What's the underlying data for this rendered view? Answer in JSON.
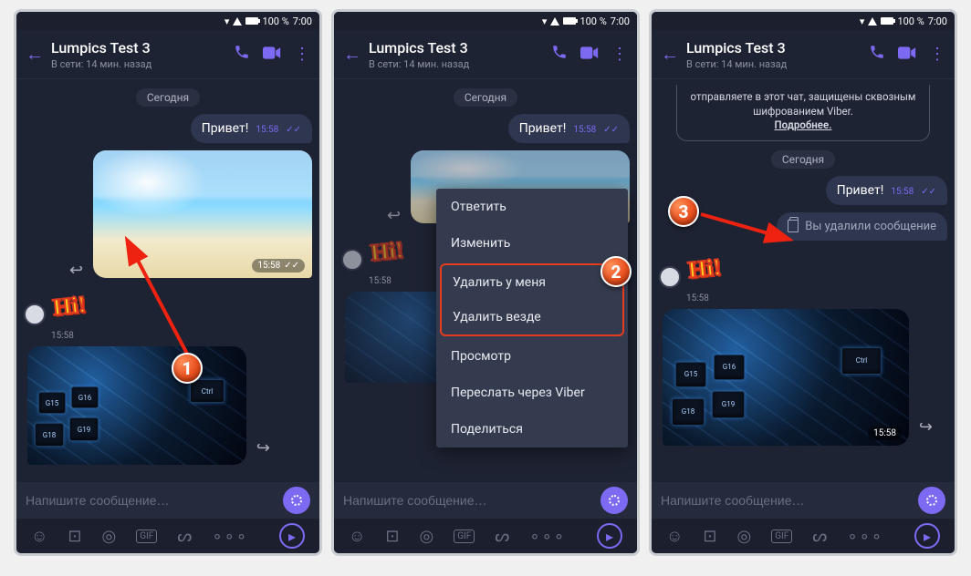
{
  "status": {
    "battery_text": "100 %",
    "clock": "7:00"
  },
  "header": {
    "title": "Lumpics Test 3",
    "subtitle": "В сети: 14 мин. назад"
  },
  "chat": {
    "date_label": "Сегодня",
    "msg_hi": "Привет!",
    "msg_time": "15:58",
    "sticker_text": "Hi!",
    "sticker_time": "15:58",
    "kbd_time": "15:58"
  },
  "input": {
    "placeholder": "Напишите сообщение…"
  },
  "menu": {
    "reply": "Ответить",
    "edit": "Изменить",
    "delete_me": "Удалить у меня",
    "delete_all": "Удалить везде",
    "view": "Просмотр",
    "forward": "Переслать через Viber",
    "share": "Поделиться"
  },
  "encryption": {
    "text": "отправляете в этот чат, защищены сквозным шифрованием Viber.",
    "more": "Подробнее."
  },
  "deleted": {
    "text": "Вы удалили сообщение"
  },
  "badges": {
    "one": "1",
    "two": "2",
    "three": "3"
  },
  "keys": {
    "ctrl": "Ctrl",
    "g15": "G15",
    "g16": "G16",
    "g18": "G18",
    "g19": "G19"
  }
}
